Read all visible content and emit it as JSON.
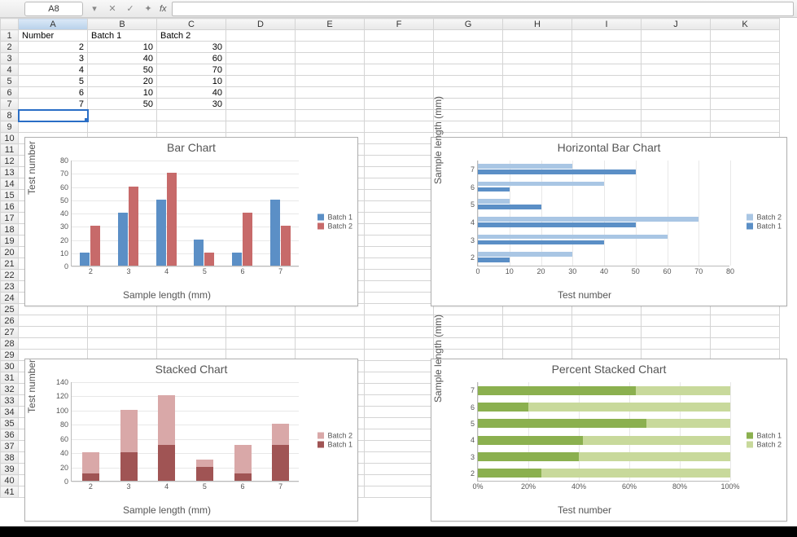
{
  "toolbar": {
    "cell_ref": "A8",
    "fx_label": "fx"
  },
  "columns": [
    "A",
    "B",
    "C",
    "D",
    "E",
    "F",
    "G",
    "H",
    "I",
    "J",
    "K"
  ],
  "rows": [
    "1",
    "2",
    "3",
    "4",
    "5",
    "6",
    "7",
    "8",
    "9",
    "10",
    "11",
    "12",
    "13",
    "14",
    "15",
    "16",
    "17",
    "18",
    "19",
    "20",
    "21",
    "22",
    "23",
    "24",
    "25",
    "26",
    "27",
    "28",
    "29",
    "30",
    "31",
    "32",
    "33",
    "34",
    "35",
    "36",
    "37",
    "38",
    "39",
    "40",
    "41"
  ],
  "headers": {
    "A": "Number",
    "B": "Batch 1",
    "C": "Batch 2"
  },
  "data_rows": [
    {
      "n": "2",
      "b1": "10",
      "b2": "30"
    },
    {
      "n": "3",
      "b1": "40",
      "b2": "60"
    },
    {
      "n": "4",
      "b1": "50",
      "b2": "70"
    },
    {
      "n": "5",
      "b1": "20",
      "b2": "10"
    },
    {
      "n": "6",
      "b1": "10",
      "b2": "40"
    },
    {
      "n": "7",
      "b1": "50",
      "b2": "30"
    }
  ],
  "selected_cell": "A8",
  "chart_data": [
    {
      "type": "bar",
      "title": "Bar Chart",
      "xlabel": "Sample length (mm)",
      "ylabel": "Test number",
      "categories": [
        "2",
        "3",
        "4",
        "5",
        "6",
        "7"
      ],
      "series": [
        {
          "name": "Batch 1",
          "values": [
            10,
            40,
            50,
            20,
            10,
            50
          ],
          "color": "#5b8fc6"
        },
        {
          "name": "Batch 2",
          "values": [
            30,
            60,
            70,
            10,
            40,
            30
          ],
          "color": "#c76a6a"
        }
      ],
      "ylim": [
        0,
        80
      ],
      "yticks": [
        0,
        10,
        20,
        30,
        40,
        50,
        60,
        70,
        80
      ]
    },
    {
      "type": "hbar",
      "title": "Horizontal Bar Chart",
      "xlabel": "Test number",
      "ylabel": "Sample length (mm)",
      "categories": [
        "2",
        "3",
        "4",
        "5",
        "6",
        "7"
      ],
      "series": [
        {
          "name": "Batch 2",
          "values": [
            30,
            60,
            70,
            10,
            40,
            30
          ],
          "color": "#a9c6e4"
        },
        {
          "name": "Batch 1",
          "values": [
            10,
            40,
            50,
            20,
            10,
            50
          ],
          "color": "#5b8fc6"
        }
      ],
      "xlim": [
        0,
        80
      ],
      "xticks": [
        0,
        10,
        20,
        30,
        40,
        50,
        60,
        70,
        80
      ]
    },
    {
      "type": "stacked_bar",
      "title": "Stacked Chart",
      "xlabel": "Sample length (mm)",
      "ylabel": "Test number",
      "categories": [
        "2",
        "3",
        "4",
        "5",
        "6",
        "7"
      ],
      "series": [
        {
          "name": "Batch 2",
          "values": [
            30,
            60,
            70,
            10,
            40,
            30
          ],
          "color": "#d9a8a8"
        },
        {
          "name": "Batch 1",
          "values": [
            10,
            40,
            50,
            20,
            10,
            50
          ],
          "color": "#a05454"
        }
      ],
      "ylim": [
        0,
        140
      ],
      "yticks": [
        0,
        20,
        40,
        60,
        80,
        100,
        120,
        140
      ]
    },
    {
      "type": "percent_stacked_hbar",
      "title": "Percent Stacked Chart",
      "xlabel": "Test number",
      "ylabel": "Sample length (mm)",
      "categories": [
        "2",
        "3",
        "4",
        "5",
        "6",
        "7"
      ],
      "series": [
        {
          "name": "Batch 1",
          "values": [
            10,
            40,
            50,
            20,
            10,
            50
          ],
          "color": "#8bb04f"
        },
        {
          "name": "Batch 2",
          "values": [
            30,
            60,
            70,
            10,
            40,
            30
          ],
          "color": "#c8d99b"
        }
      ],
      "xticks": [
        "0%",
        "20%",
        "40%",
        "60%",
        "80%",
        "100%"
      ]
    }
  ]
}
